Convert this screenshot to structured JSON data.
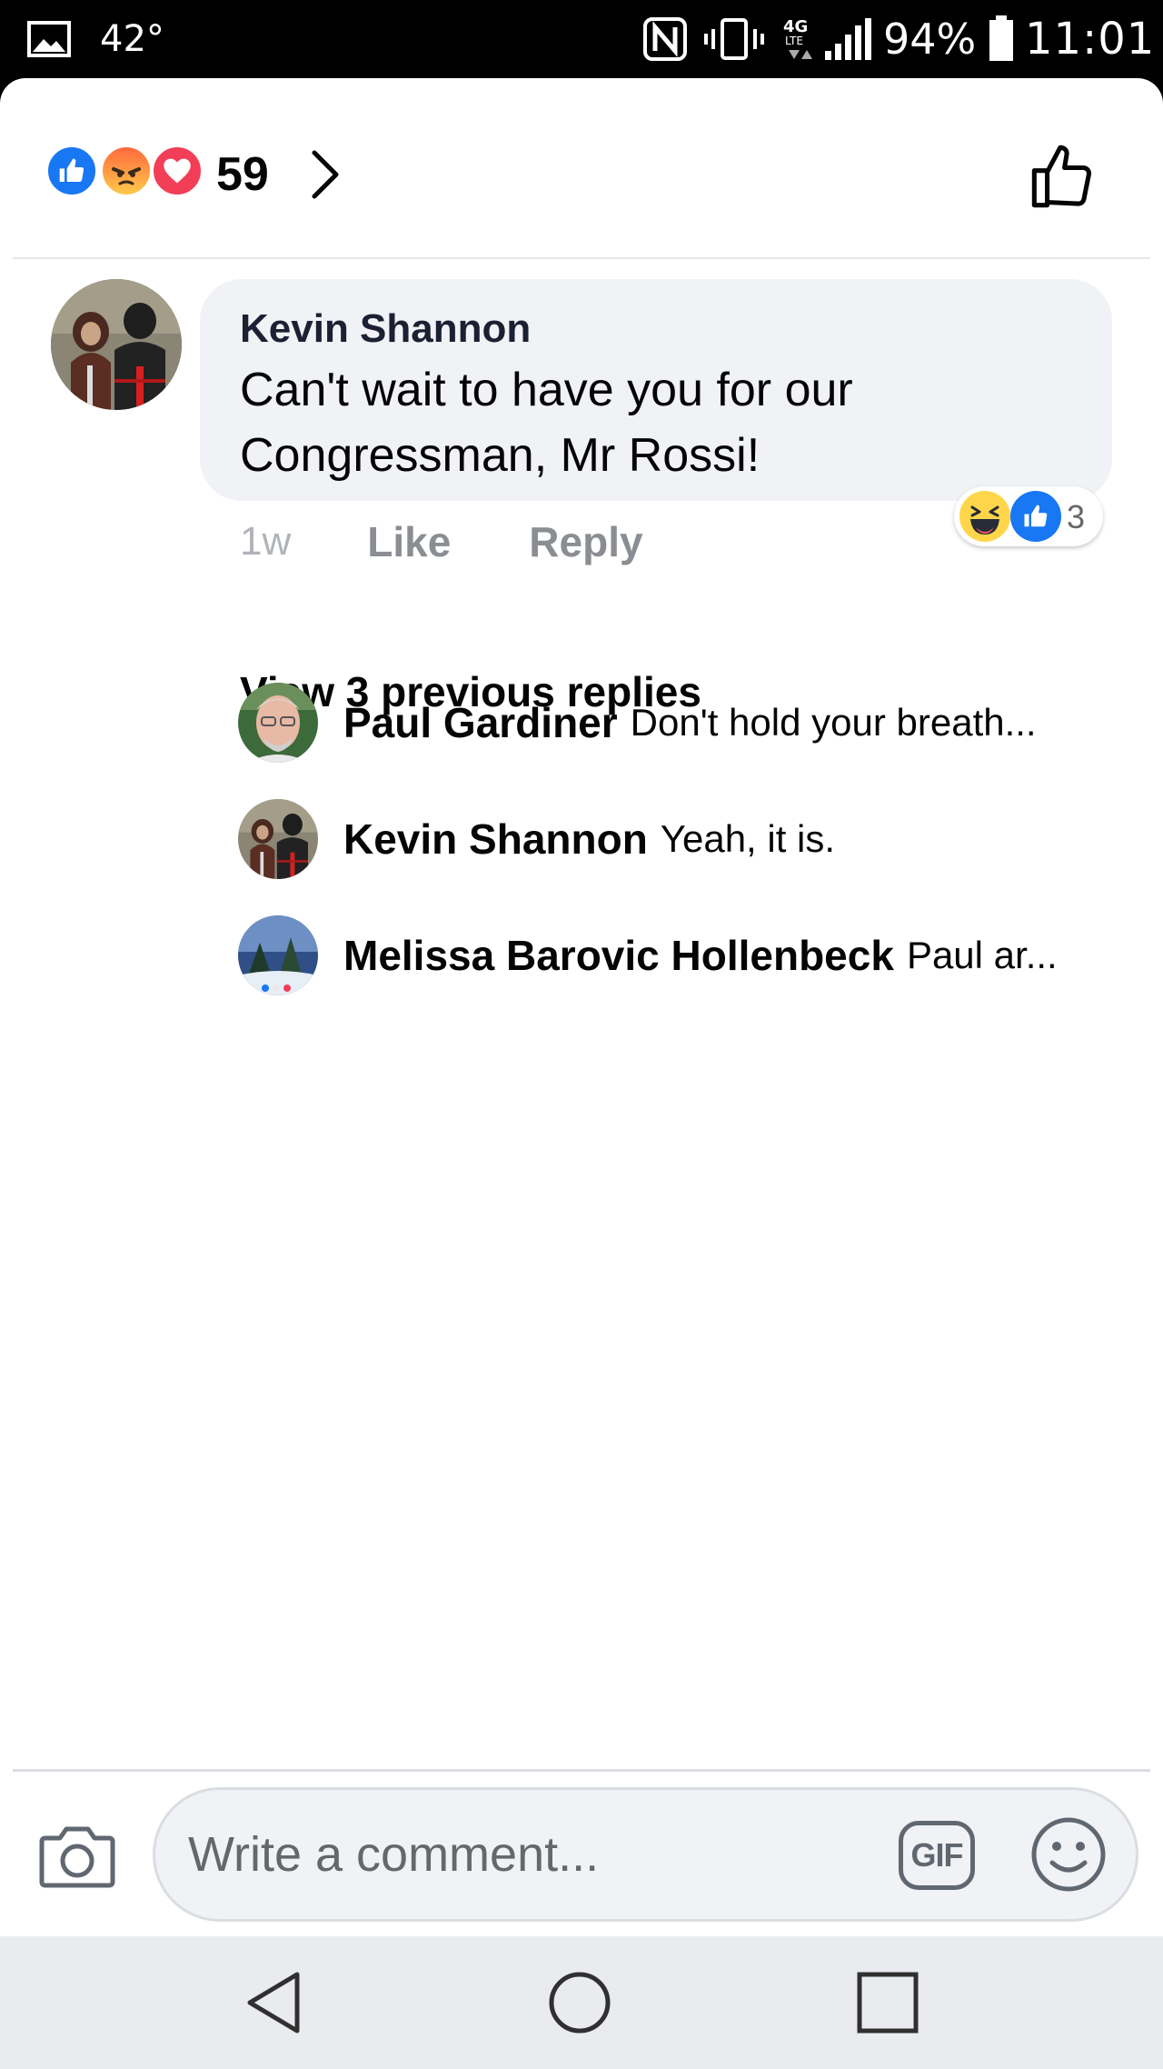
{
  "status_bar": {
    "temperature": "42°",
    "battery": "94%",
    "time": "11:01",
    "network": "4G LTE",
    "icons": [
      "gallery-icon",
      "nfc-icon",
      "vibrate-icon",
      "lte-icon",
      "signal-icon",
      "battery-icon"
    ]
  },
  "reactions": {
    "count": "59",
    "types": [
      "like",
      "angry",
      "love"
    ]
  },
  "comment": {
    "author": "Kevin Shannon",
    "text": "Can't wait to have you for our Congressman, Mr Rossi!",
    "time": "1w",
    "like_label": "Like",
    "reply_label": "Reply",
    "reactions": [
      "haha",
      "like"
    ],
    "reaction_count": "3"
  },
  "view_previous": "View 3 previous replies",
  "replies": [
    {
      "author": "Paul Gardiner",
      "text": "Don't hold your breath..."
    },
    {
      "author": "Kevin Shannon",
      "text": "Yeah, it is."
    },
    {
      "author": "Melissa Barovic Hollenbeck",
      "text": "Paul ar..."
    }
  ],
  "composer": {
    "placeholder": "Write a comment...",
    "gif_label": "GIF"
  },
  "colors": {
    "facebook_blue": "#1877f2",
    "bubble_bg": "#f0f2f5",
    "muted_text": "#8a8d91"
  }
}
